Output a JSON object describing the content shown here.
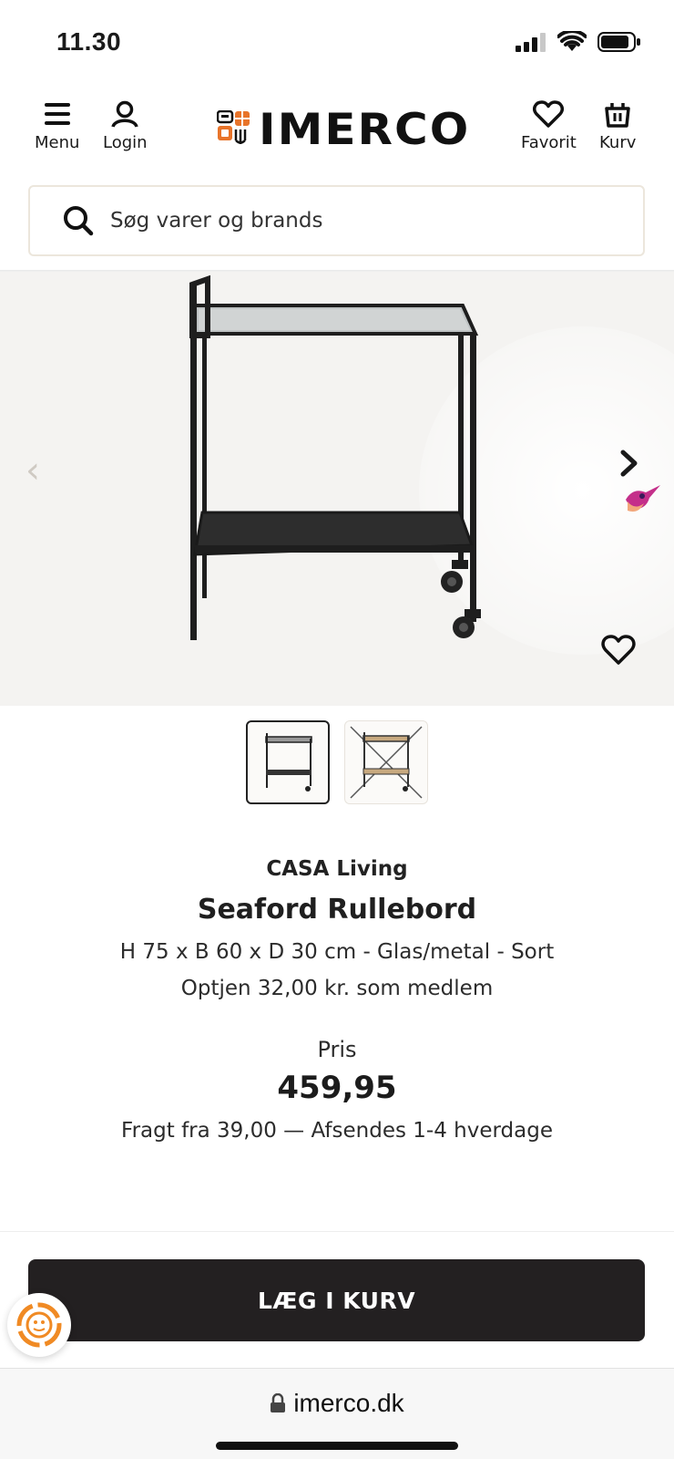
{
  "status_bar": {
    "time": "11.30",
    "icons": [
      "cellular-signal-icon",
      "wifi-icon",
      "battery-icon"
    ]
  },
  "header": {
    "menu_label": "Menu",
    "login_label": "Login",
    "logo_text": "IMERCO",
    "favorite_label": "Favorit",
    "cart_label": "Kurv"
  },
  "search": {
    "placeholder": "Søg varer og brands"
  },
  "gallery": {
    "thumbnail_count": 2,
    "active_thumbnail": 1
  },
  "product": {
    "brand": "CASA Living",
    "title": "Seaford Rullebord",
    "description": "H 75 x B 60 x D 30 cm - Glas/metal - Sort",
    "member_earn": "Optjen 32,00 kr. som medlem",
    "price_label": "Pris",
    "price": "459,95",
    "shipping": "Fragt fra 39,00 — Afsendes 1-4 hverdage"
  },
  "cart": {
    "add_to_cart_label": "LÆG I KURV"
  },
  "browser": {
    "url": "imerco.dk"
  },
  "colors": {
    "logo_orange": "#e8742a",
    "button_dark": "#232021",
    "gallery_bg": "#f4f3f1"
  }
}
